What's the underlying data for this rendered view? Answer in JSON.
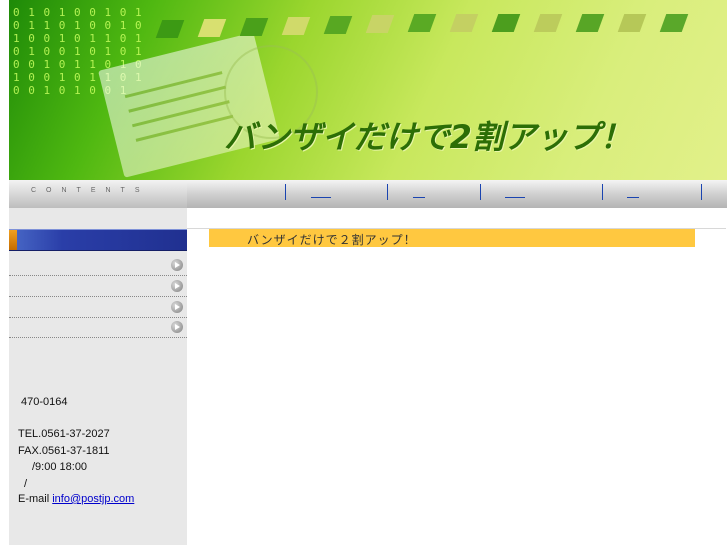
{
  "banner": {
    "title": "バンザイだけで2割アップ！",
    "binary_text": "0 1 0 1 0 0 1 0 1 0 1 1 0 1 0 0 1 0 1 0 0 1 0 1 1 0 1 0 1 0 0 1 0 1 0 1 0 0 1 0 1 1 0 1 0 1 0 0 1 0 1 1 0 1 0 0 1 0 1 0 0 1",
    "stripe_colors": [
      "#3c9a14",
      "#d8e070",
      "#4aa01a",
      "#d0da6a",
      "#58a822",
      "#c8d466",
      "#5aaa24",
      "#c4d062",
      "#4c9e1e",
      "#bccc5c",
      "#58a626",
      "#b6c858",
      "#5aa82a"
    ]
  },
  "navbar": {
    "contents_label": "CONTENTS",
    "links": [
      "",
      "",
      "",
      ""
    ]
  },
  "sidebar": {
    "menu_items": [
      "",
      "",
      "",
      ""
    ],
    "info": {
      "postal": "470-0164",
      "tel": "TEL.0561-37-2027",
      "fax": "FAX.0561-37-1811",
      "hours": "/9:00 18:00",
      "slash": "/",
      "email_label": "E-mail",
      "email": "info@postjp.com"
    }
  },
  "main": {
    "heading": "バンザイだけで２割アップ！"
  }
}
